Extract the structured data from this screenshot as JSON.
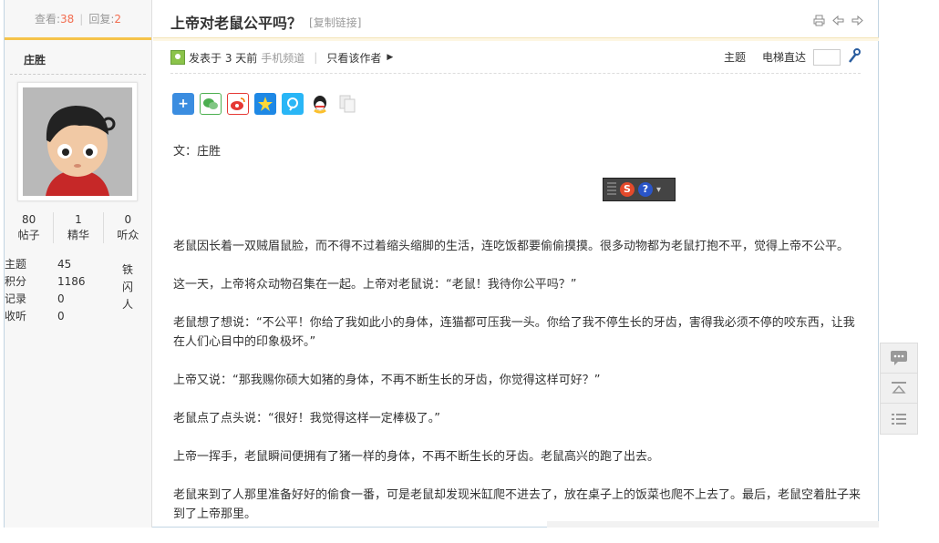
{
  "stats": {
    "views_label": "查看:",
    "views": "38",
    "replies_label": "回复:",
    "replies": "2"
  },
  "author": {
    "name": "庄胜",
    "counts": [
      {
        "value": "80",
        "label": "帖子"
      },
      {
        "value": "1",
        "label": "精华"
      },
      {
        "value": "0",
        "label": "听众"
      }
    ],
    "info": [
      {
        "key": "主题",
        "value": "45"
      },
      {
        "key": "积分",
        "value": "1186"
      },
      {
        "key": "记录",
        "value": "0"
      },
      {
        "key": "收听",
        "value": "0"
      }
    ],
    "medal": [
      "铁",
      "闪",
      "人"
    ]
  },
  "thread": {
    "title": "上帝对老鼠公平吗？",
    "copy_link": "[复制链接]",
    "posted": "发表于 3 天前",
    "channel": "手机频道",
    "only_author": "只看该作者",
    "topic": "主题",
    "elevator": "电梯直达"
  },
  "share_icons": [
    "plus-share-icon",
    "wechat-icon",
    "weibo-icon",
    "qzone-icon",
    "tencent-weibo-icon",
    "qq-icon",
    "copy-icon"
  ],
  "content": {
    "byline": "文：庄胜",
    "paragraphs": [
      "老鼠因长着一双贼眉鼠脸，而不得不过着缩头缩脚的生活，连吃饭都要偷偷摸摸。很多动物都为老鼠打抱不平，觉得上帝不公平。",
      "这一天，上帝将众动物召集在一起。上帝对老鼠说：“老鼠！我待你公平吗？”",
      "老鼠想了想说：“不公平！你给了我如此小的身体，连猫都可压我一头。你给了我不停生长的牙齿，害得我必须不停的咬东西，让我在人们心目中的印象极坏。”",
      "上帝又说：“那我赐你硕大如猪的身体，不再不断生长的牙齿，你觉得这样可好？”",
      "老鼠点了点头说：“很好！我觉得这样一定棒极了。”",
      "上帝一挥手，老鼠瞬间便拥有了猪一样的身体，不再不断生长的牙齿。老鼠高兴的跑了出去。",
      "老鼠来到了人那里准备好好的偷食一番，可是老鼠却发现米缸爬不进去了，放在桌子上的饭菜也爬不上去了。最后，老鼠空着肚子来到了上帝那里。"
    ]
  },
  "colors": {
    "accent": "#f26c4f",
    "tab_border": "#f5c34a",
    "frame_border": "#c2d5e3"
  }
}
